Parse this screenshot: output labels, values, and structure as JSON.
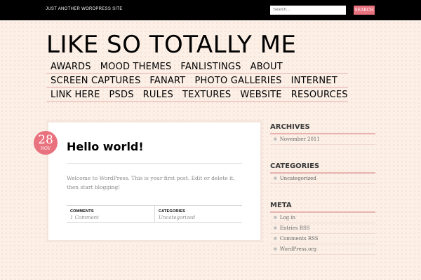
{
  "header": {
    "tagline": "JUST ANOTHER WORDPRESS SITE",
    "search_placeholder": "Search...",
    "search_button": "SEARCH"
  },
  "site": {
    "title": "LIKE SO TOTALLY ME"
  },
  "nav": {
    "rows": [
      [
        "AWARDS",
        "MOOD THEMES",
        "FANLISTINGS",
        "ABOUT"
      ],
      [
        "SCREEN CAPTURES",
        "FANART",
        "PHOTO GALLERIES",
        "INTERNET"
      ],
      [
        "LINK HERE",
        "PSDS",
        "RULES",
        "TEXTURES",
        "WEBSITE",
        "RESOURCES"
      ]
    ]
  },
  "post": {
    "day": "28",
    "month": "NOV",
    "title": "Hello world!",
    "excerpt": "Welcome to WordPress. This is your first post. Edit or delete it, then start blogging!",
    "comments_label": "COMMENTS",
    "comments_value": "1 Comment",
    "categories_label": "CATEGORIES",
    "categories_value": "Uncategorized"
  },
  "sidebar": {
    "archives": {
      "title": "ARCHIVES",
      "items": [
        "November 2011"
      ]
    },
    "categories": {
      "title": "CATEGORIES",
      "items": [
        "Uncategorized"
      ]
    },
    "meta": {
      "title": "META",
      "items": [
        "Log in",
        "Entries RSS",
        "Comments RSS",
        "WordPress.org"
      ]
    }
  },
  "colors": {
    "accent": "#e8727e",
    "background": "#fbefe6",
    "topbar": "#000000"
  }
}
